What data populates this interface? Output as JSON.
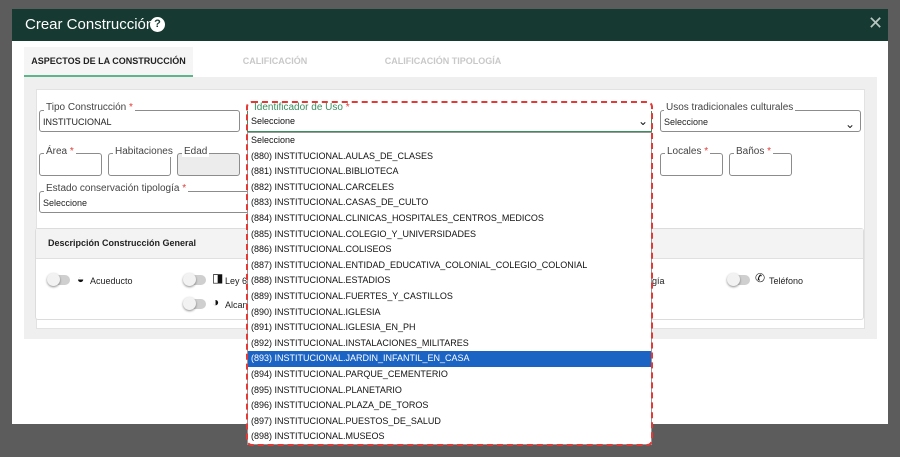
{
  "modal": {
    "title": "Crear Construcción",
    "close": "✕",
    "help": "?"
  },
  "tabs": [
    {
      "label": "ASPECTOS DE LA CONSTRUCCIÓN"
    },
    {
      "label": "CALIFICACIÓN"
    },
    {
      "label": "CALIFICACIÓN TIPOLOGÍA"
    }
  ],
  "form": {
    "tipo": {
      "label": "Tipo Construcción",
      "value": "INSTITUCIONAL"
    },
    "usos": {
      "label": "Usos tradicionales culturales",
      "value": "Seleccione"
    },
    "area": {
      "label": "Área"
    },
    "habitaciones": {
      "label": "Habitaciones"
    },
    "edad": {
      "label": "Edad"
    },
    "locales": {
      "label": "Locales"
    },
    "banos": {
      "label": "Baños"
    },
    "estado": {
      "label": "Estado conservación tipología",
      "value": "Seleccione"
    },
    "required_mark": "*"
  },
  "description": {
    "title": "Descripción Construcción General",
    "services": [
      {
        "label": "Acueducto",
        "icon": "water-drop-icon"
      },
      {
        "label": "Ley 6",
        "icon": "book-icon"
      },
      {
        "label": "Alcan",
        "icon": "half-circle-icon"
      },
      {
        "label": "gía",
        "icon": "energy-icon"
      },
      {
        "label": "Teléfono",
        "icon": "phone-icon"
      }
    ]
  },
  "dropdown": {
    "label": "Identificador de Uso",
    "selected": "Seleccione",
    "options": [
      "Seleccione",
      "(880) INSTITUCIONAL.AULAS_DE_CLASES",
      "(881) INSTITUCIONAL.BIBLIOTECA",
      "(882) INSTITUCIONAL.CARCELES",
      "(883) INSTITUCIONAL.CASAS_DE_CULTO",
      "(884) INSTITUCIONAL.CLINICAS_HOSPITALES_CENTROS_MEDICOS",
      "(885) INSTITUCIONAL.COLEGIO_Y_UNIVERSIDADES",
      "(886) INSTITUCIONAL.COLISEOS",
      "(887) INSTITUCIONAL.ENTIDAD_EDUCATIVA_COLONIAL_COLEGIO_COLONIAL",
      "(888) INSTITUCIONAL.ESTADIOS",
      "(889) INSTITUCIONAL.FUERTES_Y_CASTILLOS",
      "(890) INSTITUCIONAL.IGLESIA",
      "(891) INSTITUCIONAL.IGLESIA_EN_PH",
      "(892) INSTITUCIONAL.INSTALACIONES_MILITARES",
      "(893) INSTITUCIONAL.JARDIN_INFANTIL_EN_CASA",
      "(894) INSTITUCIONAL.PARQUE_CEMENTERIO",
      "(895) INSTITUCIONAL.PLANETARIO",
      "(896) INSTITUCIONAL.PLAZA_DE_TOROS",
      "(897) INSTITUCIONAL.PUESTOS_DE_SALUD",
      "(898) INSTITUCIONAL.MUSEOS"
    ],
    "highlighted": "(893) INSTITUCIONAL.JARDIN_INFANTIL_EN_CASA"
  },
  "colors": {
    "header": "#163a31",
    "accent_green": "#3a8f5e",
    "required_red": "#e53935",
    "highlight_blue": "#1c64c4"
  }
}
